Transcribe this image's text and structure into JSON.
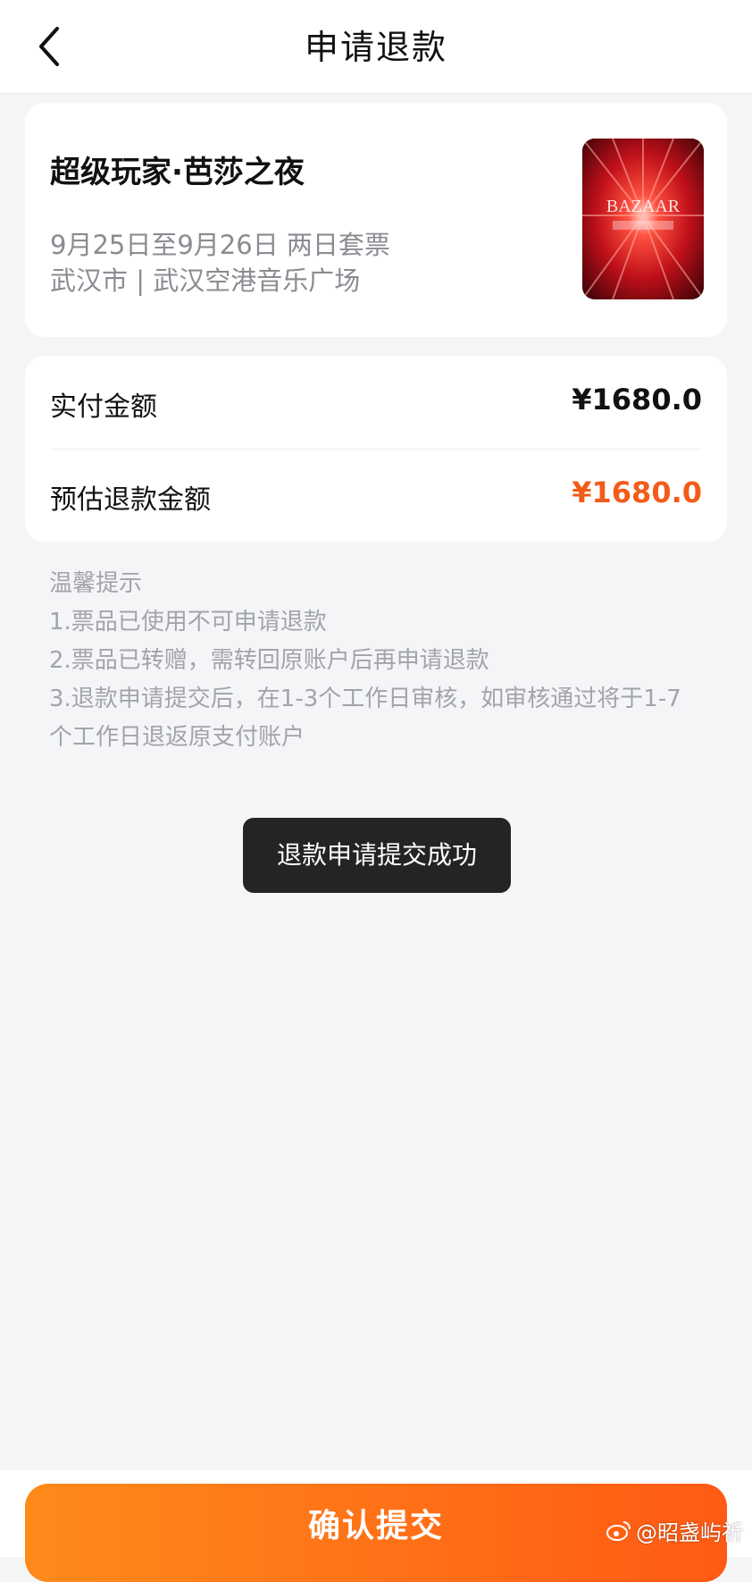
{
  "nav": {
    "back_icon": "chevron-left-icon",
    "title": "申请退款"
  },
  "event": {
    "name": "超级玩家·芭莎之夜",
    "dates": "9月25日至9月26日 两日套票",
    "venue": "武汉市 | 武汉空港音乐广场",
    "poster_text": "BAZAAR"
  },
  "payment": {
    "paid_label": "实付金额",
    "paid_value": "¥1680.0",
    "refund_label": "预估退款金额",
    "refund_value": "¥1680.0",
    "refund_color": "#f25c19"
  },
  "tips": {
    "title": "温馨提示",
    "items": [
      "1.票品已使用不可申请退款",
      "2.票品已转赠，需转回原账户后再申请退款",
      "3.退款申请提交后，在1-3个工作日审核，如审核通过将于1-7",
      "个工作日退返原支付账户"
    ]
  },
  "toast": {
    "text": "退款申请提交成功"
  },
  "footer": {
    "submit_label": "确认提交",
    "accent_start": "#ff8a1a",
    "accent_end": "#ff5a14"
  },
  "watermark": {
    "text": "@昭盏屿祈",
    "icon": "weibo-icon"
  }
}
